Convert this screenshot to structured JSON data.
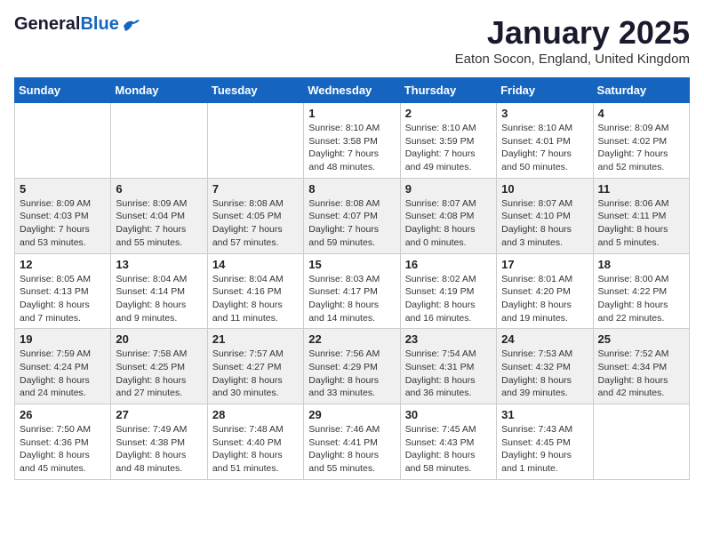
{
  "header": {
    "logo_general": "General",
    "logo_blue": "Blue",
    "month_title": "January 2025",
    "location": "Eaton Socon, England, United Kingdom"
  },
  "days_of_week": [
    "Sunday",
    "Monday",
    "Tuesday",
    "Wednesday",
    "Thursday",
    "Friday",
    "Saturday"
  ],
  "weeks": [
    [
      {
        "day": "",
        "data": ""
      },
      {
        "day": "",
        "data": ""
      },
      {
        "day": "",
        "data": ""
      },
      {
        "day": "1",
        "data": "Sunrise: 8:10 AM\nSunset: 3:58 PM\nDaylight: 7 hours\nand 48 minutes."
      },
      {
        "day": "2",
        "data": "Sunrise: 8:10 AM\nSunset: 3:59 PM\nDaylight: 7 hours\nand 49 minutes."
      },
      {
        "day": "3",
        "data": "Sunrise: 8:10 AM\nSunset: 4:01 PM\nDaylight: 7 hours\nand 50 minutes."
      },
      {
        "day": "4",
        "data": "Sunrise: 8:09 AM\nSunset: 4:02 PM\nDaylight: 7 hours\nand 52 minutes."
      }
    ],
    [
      {
        "day": "5",
        "data": "Sunrise: 8:09 AM\nSunset: 4:03 PM\nDaylight: 7 hours\nand 53 minutes."
      },
      {
        "day": "6",
        "data": "Sunrise: 8:09 AM\nSunset: 4:04 PM\nDaylight: 7 hours\nand 55 minutes."
      },
      {
        "day": "7",
        "data": "Sunrise: 8:08 AM\nSunset: 4:05 PM\nDaylight: 7 hours\nand 57 minutes."
      },
      {
        "day": "8",
        "data": "Sunrise: 8:08 AM\nSunset: 4:07 PM\nDaylight: 7 hours\nand 59 minutes."
      },
      {
        "day": "9",
        "data": "Sunrise: 8:07 AM\nSunset: 4:08 PM\nDaylight: 8 hours\nand 0 minutes."
      },
      {
        "day": "10",
        "data": "Sunrise: 8:07 AM\nSunset: 4:10 PM\nDaylight: 8 hours\nand 3 minutes."
      },
      {
        "day": "11",
        "data": "Sunrise: 8:06 AM\nSunset: 4:11 PM\nDaylight: 8 hours\nand 5 minutes."
      }
    ],
    [
      {
        "day": "12",
        "data": "Sunrise: 8:05 AM\nSunset: 4:13 PM\nDaylight: 8 hours\nand 7 minutes."
      },
      {
        "day": "13",
        "data": "Sunrise: 8:04 AM\nSunset: 4:14 PM\nDaylight: 8 hours\nand 9 minutes."
      },
      {
        "day": "14",
        "data": "Sunrise: 8:04 AM\nSunset: 4:16 PM\nDaylight: 8 hours\nand 11 minutes."
      },
      {
        "day": "15",
        "data": "Sunrise: 8:03 AM\nSunset: 4:17 PM\nDaylight: 8 hours\nand 14 minutes."
      },
      {
        "day": "16",
        "data": "Sunrise: 8:02 AM\nSunset: 4:19 PM\nDaylight: 8 hours\nand 16 minutes."
      },
      {
        "day": "17",
        "data": "Sunrise: 8:01 AM\nSunset: 4:20 PM\nDaylight: 8 hours\nand 19 minutes."
      },
      {
        "day": "18",
        "data": "Sunrise: 8:00 AM\nSunset: 4:22 PM\nDaylight: 8 hours\nand 22 minutes."
      }
    ],
    [
      {
        "day": "19",
        "data": "Sunrise: 7:59 AM\nSunset: 4:24 PM\nDaylight: 8 hours\nand 24 minutes."
      },
      {
        "day": "20",
        "data": "Sunrise: 7:58 AM\nSunset: 4:25 PM\nDaylight: 8 hours\nand 27 minutes."
      },
      {
        "day": "21",
        "data": "Sunrise: 7:57 AM\nSunset: 4:27 PM\nDaylight: 8 hours\nand 30 minutes."
      },
      {
        "day": "22",
        "data": "Sunrise: 7:56 AM\nSunset: 4:29 PM\nDaylight: 8 hours\nand 33 minutes."
      },
      {
        "day": "23",
        "data": "Sunrise: 7:54 AM\nSunset: 4:31 PM\nDaylight: 8 hours\nand 36 minutes."
      },
      {
        "day": "24",
        "data": "Sunrise: 7:53 AM\nSunset: 4:32 PM\nDaylight: 8 hours\nand 39 minutes."
      },
      {
        "day": "25",
        "data": "Sunrise: 7:52 AM\nSunset: 4:34 PM\nDaylight: 8 hours\nand 42 minutes."
      }
    ],
    [
      {
        "day": "26",
        "data": "Sunrise: 7:50 AM\nSunset: 4:36 PM\nDaylight: 8 hours\nand 45 minutes."
      },
      {
        "day": "27",
        "data": "Sunrise: 7:49 AM\nSunset: 4:38 PM\nDaylight: 8 hours\nand 48 minutes."
      },
      {
        "day": "28",
        "data": "Sunrise: 7:48 AM\nSunset: 4:40 PM\nDaylight: 8 hours\nand 51 minutes."
      },
      {
        "day": "29",
        "data": "Sunrise: 7:46 AM\nSunset: 4:41 PM\nDaylight: 8 hours\nand 55 minutes."
      },
      {
        "day": "30",
        "data": "Sunrise: 7:45 AM\nSunset: 4:43 PM\nDaylight: 8 hours\nand 58 minutes."
      },
      {
        "day": "31",
        "data": "Sunrise: 7:43 AM\nSunset: 4:45 PM\nDaylight: 9 hours\nand 1 minute."
      },
      {
        "day": "",
        "data": ""
      }
    ]
  ]
}
